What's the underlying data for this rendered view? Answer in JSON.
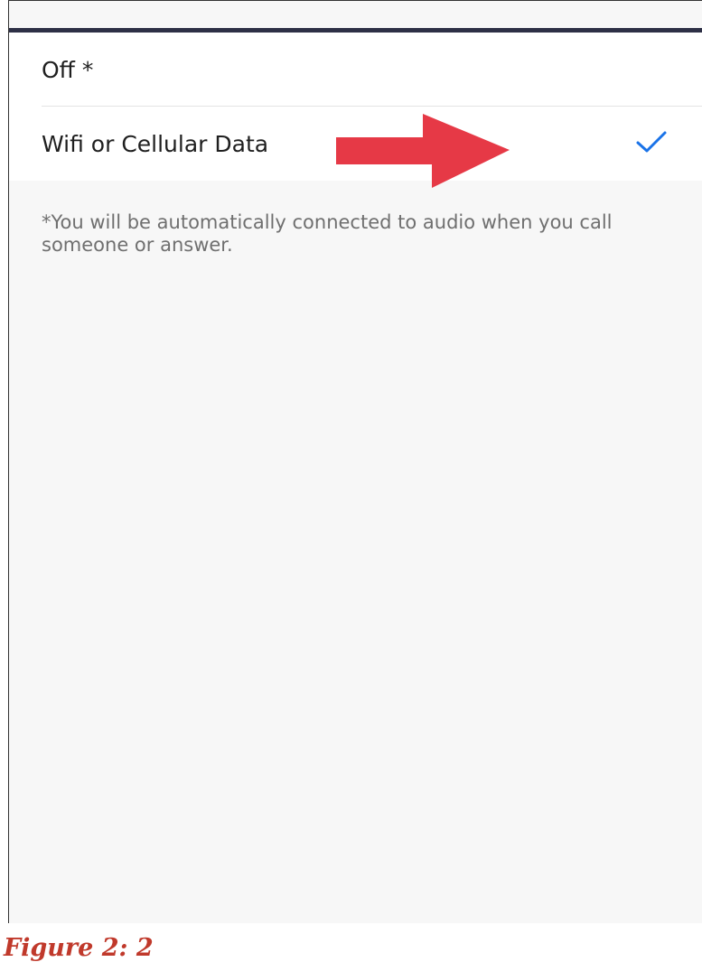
{
  "settings": {
    "options": [
      {
        "label": "Off *",
        "selected": false
      },
      {
        "label": "Wifi or Cellular Data",
        "selected": true
      }
    ],
    "footnote": "*You will be automatically connected to audio when you call someone or answer."
  },
  "annotation": {
    "arrow_color": "#e63946"
  },
  "caption": "Figure 2: 2",
  "colors": {
    "accent": "#1a73e8",
    "header_bar": "#2e3046",
    "background": "#f7f7f7",
    "caption": "#c0392b"
  }
}
